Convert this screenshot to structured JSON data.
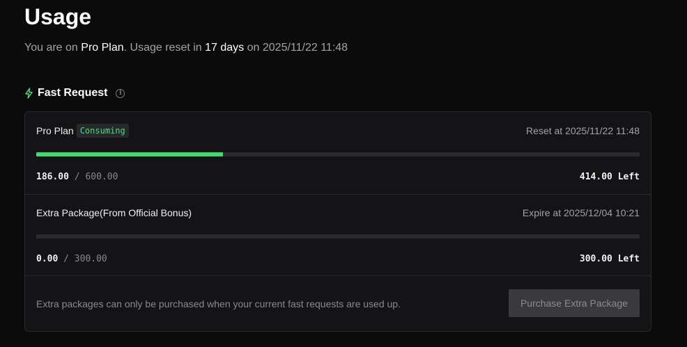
{
  "header": {
    "title": "Usage",
    "subtitle": {
      "prefix": "You are on ",
      "plan": "Pro Plan",
      "middle": ". Usage reset in ",
      "days": "17 days",
      "suffix": " on 2025/11/22 11:48"
    }
  },
  "section": {
    "title": "Fast Request",
    "info_icon": "i",
    "icon": "bolt-icon",
    "accent_color": "#4ade80"
  },
  "pro_plan": {
    "name": "Pro Plan",
    "badge": "Consuming",
    "reset_text": "Reset at 2025/11/22 11:48",
    "used": "186.00",
    "separator": "/",
    "total": "600.00",
    "left": "414.00 Left",
    "progress_fraction": 0.31
  },
  "extra_package": {
    "name": "Extra Package(From Official Bonus)",
    "expire_text": "Expire at 2025/12/04 10:21",
    "used": "0.00",
    "separator": "/",
    "total": "300.00",
    "left": "300.00 Left",
    "progress_fraction": 0
  },
  "footer": {
    "note": "Extra packages can only be purchased when your current fast requests are used up.",
    "button_label": "Purchase Extra Package"
  }
}
